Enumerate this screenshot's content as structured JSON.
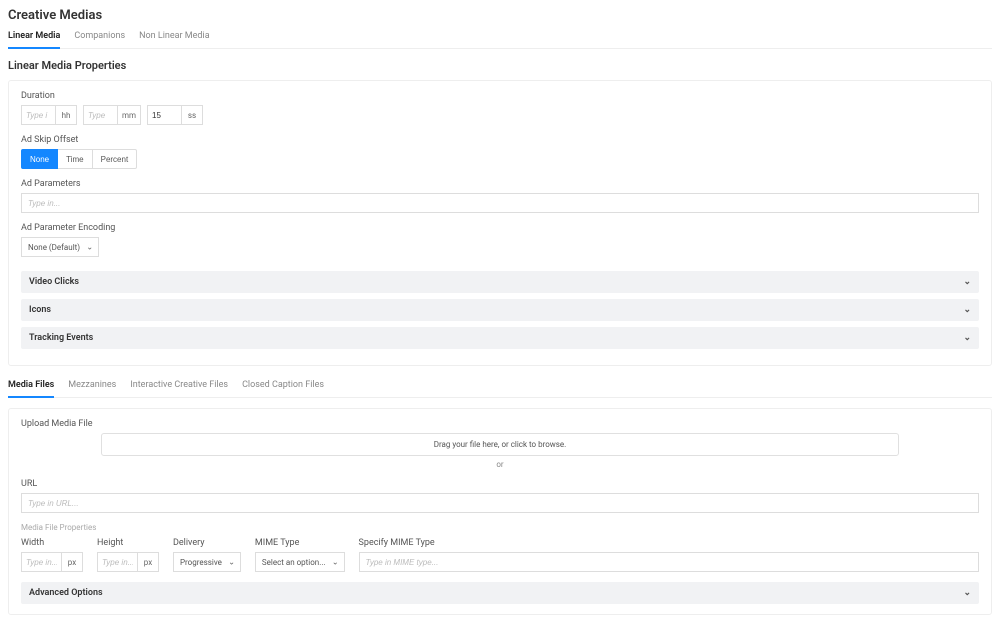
{
  "pageTitle": "Creative Medias",
  "mainTabs": [
    {
      "label": "Linear Media",
      "active": true
    },
    {
      "label": "Companions",
      "active": false
    },
    {
      "label": "Non Linear Media",
      "active": false
    }
  ],
  "sectionTitle": "Linear Media Properties",
  "duration": {
    "label": "Duration",
    "hh": {
      "placeholder": "Type i",
      "unit": "hh",
      "value": ""
    },
    "mm": {
      "placeholder": "Type",
      "unit": "mm",
      "value": ""
    },
    "ss": {
      "placeholder": "",
      "unit": "ss",
      "value": "15"
    }
  },
  "adSkip": {
    "label": "Ad Skip Offset",
    "options": [
      "None",
      "Time",
      "Percent"
    ],
    "selected": "None"
  },
  "adParams": {
    "label": "Ad Parameters",
    "placeholder": "Type in...",
    "value": ""
  },
  "adParamEnc": {
    "label": "Ad Parameter Encoding",
    "value": "None (Default)"
  },
  "collapsibles": [
    "Video Clicks",
    "Icons",
    "Tracking Events"
  ],
  "fileTabs": [
    {
      "label": "Media Files",
      "active": true
    },
    {
      "label": "Mezzanines",
      "active": false
    },
    {
      "label": "Interactive Creative Files",
      "active": false
    },
    {
      "label": "Closed Caption Files",
      "active": false
    }
  ],
  "upload": {
    "label": "Upload Media File",
    "dropText": "Drag your file here, or click to browse.",
    "or": "or"
  },
  "url": {
    "label": "URL",
    "placeholder": "Type in URL...",
    "value": ""
  },
  "mediaProps": {
    "header": "Media File Properties",
    "width": {
      "label": "Width",
      "placeholder": "Type in...",
      "unit": "px",
      "value": ""
    },
    "height": {
      "label": "Height",
      "placeholder": "Type in...",
      "unit": "px",
      "value": ""
    },
    "delivery": {
      "label": "Delivery",
      "value": "Progressive"
    },
    "mimeType": {
      "label": "MIME Type",
      "value": "Select an option..."
    },
    "specifyMime": {
      "label": "Specify MIME Type",
      "placeholder": "Type in MIME type...",
      "value": ""
    }
  },
  "advanced": "Advanced Options"
}
